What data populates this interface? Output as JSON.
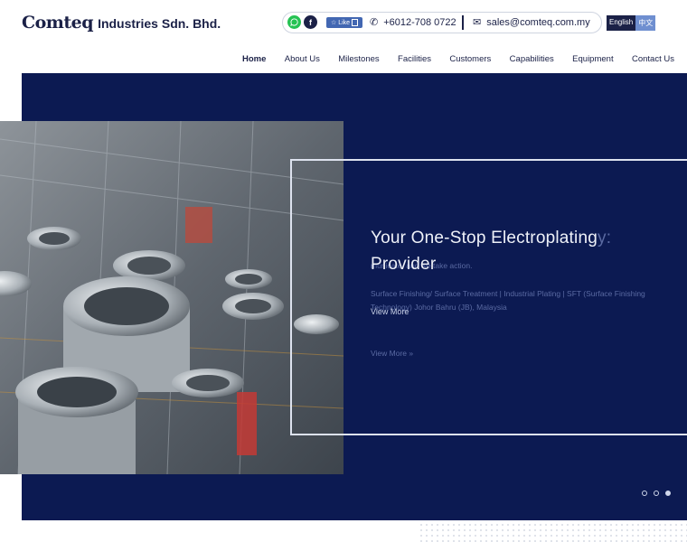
{
  "header": {
    "brand": "Comteq",
    "company_rest": "Industries Sdn. Bhd.",
    "social": {
      "whatsapp_icon": "whatsapp-icon",
      "facebook_icon": "facebook-icon",
      "facebook_letter": "f",
      "like_label": "Like"
    },
    "phone": "+6012-708 0722",
    "email": "sales@comteq.com.my",
    "languages": [
      "English",
      "中文"
    ]
  },
  "nav": {
    "items": [
      "Home",
      "About Us",
      "Milestones",
      "Facilities",
      "Customers",
      "Capabilities",
      "Equipment",
      "Contact Us"
    ],
    "active": "Home"
  },
  "hero": {
    "title_line1": "Your One-Stop Electroplating",
    "title_line1_tail": "y:",
    "title_line2": "Provider",
    "ghost_line1": "municate, and we take action.",
    "ghost_line2": "Surface Finishing/ Surface Treatment | Industrial Plating | SFT (Surface Finishing Technology) Johor Bahru (JB), Malaysia",
    "view_more": "View More",
    "ghost_view_more": "View More »",
    "slides_total": 3,
    "slide_active": 3
  },
  "colors": {
    "navy": "#1b2147",
    "hero_bg": "#0c1a52",
    "whatsapp": "#25c253",
    "facebook": "#4267b2"
  }
}
